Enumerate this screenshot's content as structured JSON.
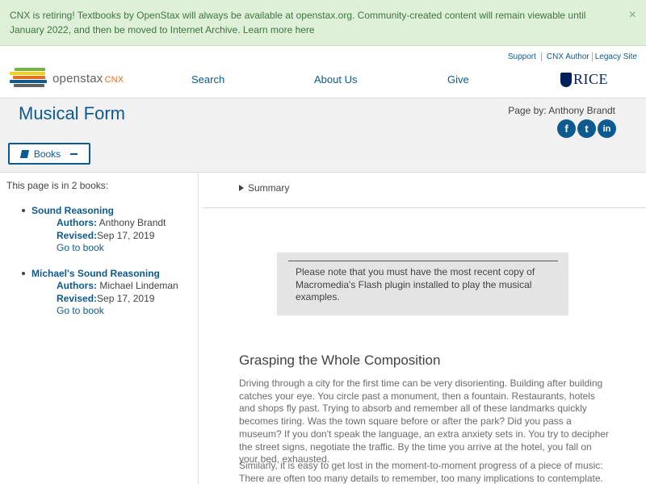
{
  "banner": {
    "message": "CNX is retiring! Textbooks by OpenStax will always be available at openstax.org. Community-created content will remain viewable until January 2022, and then be moved to Internet Archive.",
    "link": "Learn more here",
    "close": "×"
  },
  "util_links": {
    "support": "Support",
    "author": "CNX Author",
    "legacy": "Legacy Site"
  },
  "logo": {
    "brand": "openstax",
    "suffix": "CNX"
  },
  "nav": {
    "search": "Search",
    "about": "About Us",
    "give": "Give"
  },
  "rice": "RICE",
  "page": {
    "title": "Musical Form",
    "by": "Page by: Anthony Brandt"
  },
  "social": {
    "facebook": "f",
    "twitter": "t",
    "linkedin": "in"
  },
  "books_button": "Books",
  "sidebar": {
    "heading": "This page is in 2 books:",
    "books": [
      {
        "title": "Sound Reasoning",
        "authors_label": "Authors:",
        "authors": " Anthony Brandt",
        "revised_label": "Revised:",
        "revised": "Sep 17, 2019",
        "link": "Go to book"
      },
      {
        "title": "Michael's Sound Reasoning",
        "authors_label": "Authors:",
        "authors": " Michael Lindeman",
        "revised_label": "Revised:",
        "revised": "Sep 17, 2019",
        "link": "Go to book"
      }
    ]
  },
  "content": {
    "summary": "Summary",
    "note": "Please note that you must have the most recent copy of Macromedia's Flash plugin installed to play the musical examples.",
    "section_title": "Grasping the Whole Composition",
    "para1": "Driving through a city for the first time can be very disorienting. Building after building catches your eye. You circle past a monument, then a fountain. Restaurants, hotels and shops fly past. Trying to absorb and remember all of these landmarks quickly becomes tiring. Was the town square before or after the park? Did you pass a museum? If you don't speak the language, an extra anxiety sets in. You try to decipher the street signs, negotiate the traffic. By the time you arrive at the hotel, you fall on your bed, exhausted.",
    "para2": "Similarly, it is easy to get lost in the moment-to-moment progress of a piece of music: There are often too many details to remember, too many implications to contemplate. If the work is"
  },
  "colors": {
    "link": "#0d5a8f",
    "banner_bg": "#dff0d8",
    "banner_text": "#3c763d",
    "accent": "#e66e24"
  }
}
